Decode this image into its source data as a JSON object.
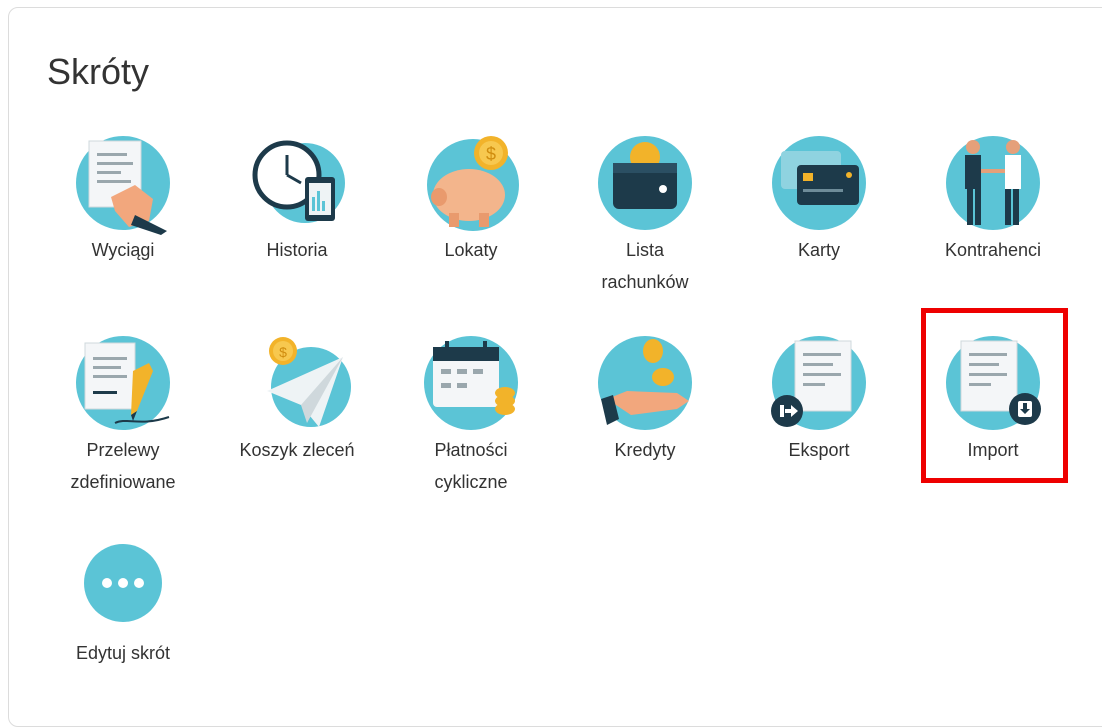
{
  "title": "Skróty",
  "colors": {
    "teal": "#5bc4d6",
    "navy": "#1d3a4a",
    "highlight": "#ee0000",
    "gold": "#f2b32a"
  },
  "shortcuts": [
    {
      "label": "Wyciągi",
      "icon": "statement-icon"
    },
    {
      "label": "Historia",
      "icon": "clock-history-icon"
    },
    {
      "label": "Lokaty",
      "icon": "piggy-bank-icon"
    },
    {
      "label": "Lista\nrachunków",
      "icon": "wallet-icon"
    },
    {
      "label": "Karty",
      "icon": "cards-icon"
    },
    {
      "label": "Kontrahenci",
      "icon": "handshake-icon"
    },
    {
      "label": "Przelewy\nzdefiniowane",
      "icon": "signed-document-icon"
    },
    {
      "label": "Koszyk zleceń",
      "icon": "paper-plane-icon"
    },
    {
      "label": "Płatności\ncykliczne",
      "icon": "calendar-coins-icon"
    },
    {
      "label": "Kredyty",
      "icon": "hand-coins-icon"
    },
    {
      "label": "Eksport",
      "icon": "export-document-icon"
    },
    {
      "label": "Import",
      "icon": "import-document-icon"
    },
    {
      "label": "Edytuj skrót",
      "icon": "more-dots-icon"
    }
  ]
}
